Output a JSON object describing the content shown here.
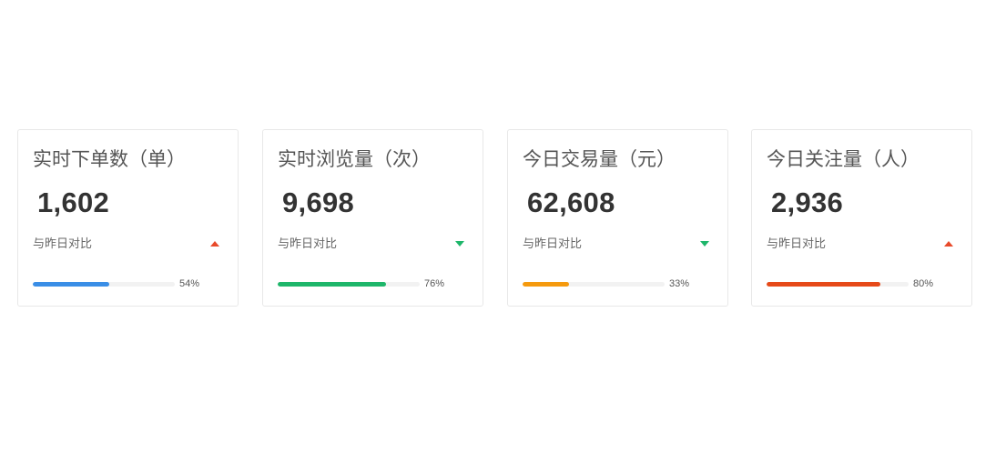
{
  "comparison_label": "与昨日对比",
  "cards": [
    {
      "title": "实时下单数（单）",
      "value": "1,602",
      "trend": "up",
      "trend_color": "#e84a2a",
      "progress": 0.54,
      "progress_text": "54%",
      "bar_color": "#3a8ee6"
    },
    {
      "title": "实时浏览量（次）",
      "value": "9,698",
      "trend": "down",
      "trend_color": "#1eb66a",
      "progress": 0.76,
      "progress_text": "76%",
      "bar_color": "#1eb66a"
    },
    {
      "title": "今日交易量（元）",
      "value": "62,608",
      "trend": "down",
      "trend_color": "#1eb66a",
      "progress": 0.33,
      "progress_text": "33%",
      "bar_color": "#f59a0e"
    },
    {
      "title": "今日关注量（人）",
      "value": "2,936",
      "trend": "up",
      "trend_color": "#e84a2a",
      "progress": 0.8,
      "progress_text": "80%",
      "bar_color": "#e64a19"
    }
  ]
}
